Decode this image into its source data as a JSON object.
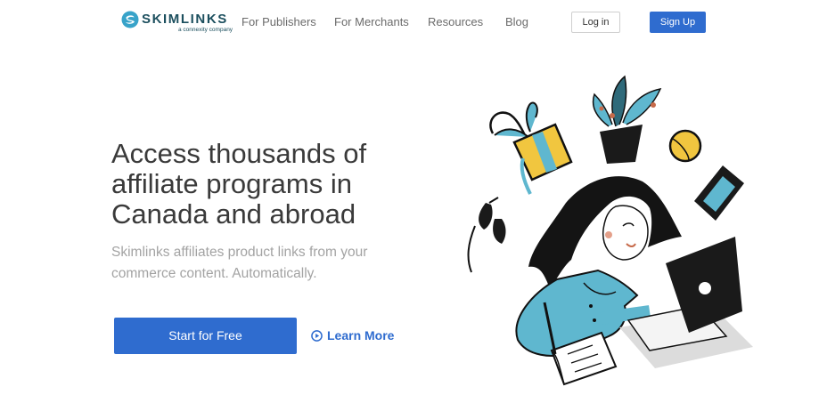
{
  "brand": {
    "name": "SKIMLINKS",
    "tagline": "a connexity company",
    "color": "#1c4f5e",
    "accent": "#2f6ccf"
  },
  "nav": {
    "items": [
      {
        "label": "For Publishers"
      },
      {
        "label": "For Merchants"
      },
      {
        "label": "Resources"
      },
      {
        "label": "Blog"
      }
    ],
    "login_label": "Log in",
    "signup_label": "Sign Up"
  },
  "hero": {
    "headline": "Access thousands of affiliate programs in Canada and abroad",
    "subtext": "Skimlinks affiliates product links from your commerce content. Automatically.",
    "primary_cta": "Start for Free",
    "secondary_cta": "Learn More",
    "secondary_cta_icon": "play-circle-icon",
    "illustration": "woman-on-laptop-illustration"
  }
}
